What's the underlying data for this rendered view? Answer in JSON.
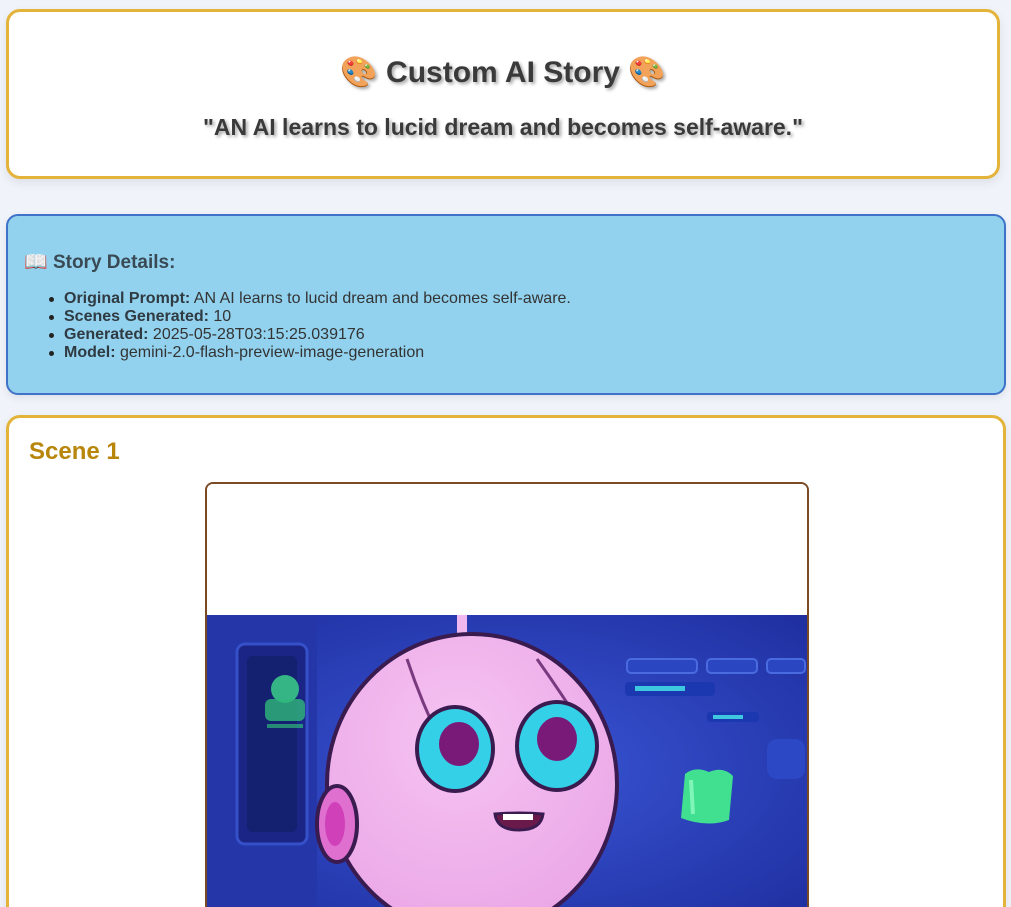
{
  "header": {
    "title_emoji_left": "🎨",
    "title": "Custom AI Story",
    "title_emoji_right": "🎨",
    "subtitle": "\"AN AI learns to lucid dream and becomes self-aware.\""
  },
  "details": {
    "heading_icon": "📖",
    "heading": "Story Details:",
    "items": [
      {
        "key": "Original Prompt:",
        "value": "AN AI learns to lucid dream and becomes self-aware."
      },
      {
        "key": "Scenes Generated:",
        "value": "10"
      },
      {
        "key": "Generated:",
        "value": "2025-05-28T03:15:25.039176"
      },
      {
        "key": "Model:",
        "value": "gemini-2.0-flash-preview-image-generation"
      }
    ]
  },
  "scene": {
    "title": "Scene 1",
    "image_description_icon": "robot-illustration"
  },
  "colors": {
    "accent_gold": "#e3b33a",
    "scene_title": "#b8860b",
    "details_bg": "#92d2ee",
    "details_border": "#3f72c8"
  }
}
